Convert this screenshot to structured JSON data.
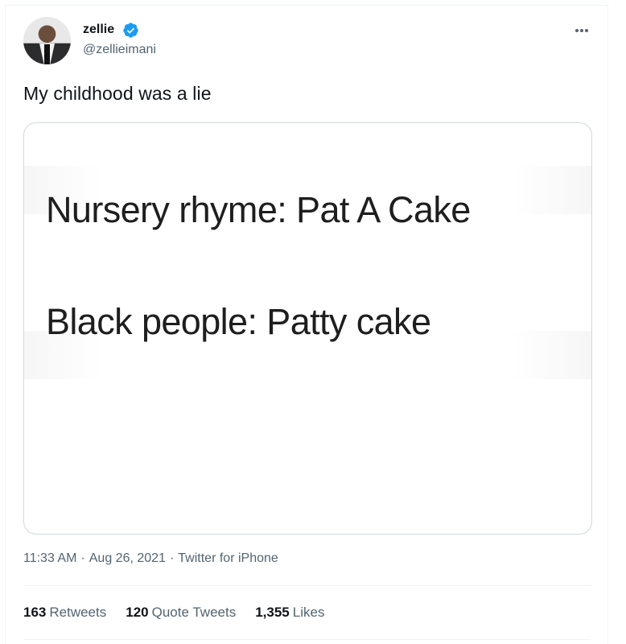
{
  "tweet": {
    "author": {
      "display_name": "zellie",
      "handle": "@zellieimani",
      "verified": true
    },
    "text": "My childhood was a lie",
    "media": {
      "line_1": "Nursery rhyme: Pat A Cake",
      "line_2": "Black people: Patty cake"
    },
    "meta": {
      "time": "11:33 AM",
      "date": "Aug 26, 2021",
      "source": "Twitter for iPhone",
      "separator": "·"
    },
    "stats": {
      "retweets_count": "163",
      "retweets_label": "Retweets",
      "quote_tweets_count": "120",
      "quote_tweets_label": "Quote Tweets",
      "likes_count": "1,355",
      "likes_label": "Likes"
    }
  },
  "icons": {
    "verified_badge": "verified-badge-icon",
    "more_options": "more-options-icon"
  },
  "colors": {
    "verified_blue": "#1d9bf0",
    "secondary_text": "#536471",
    "primary_text": "#0f1419",
    "border": "#cfd9de"
  }
}
